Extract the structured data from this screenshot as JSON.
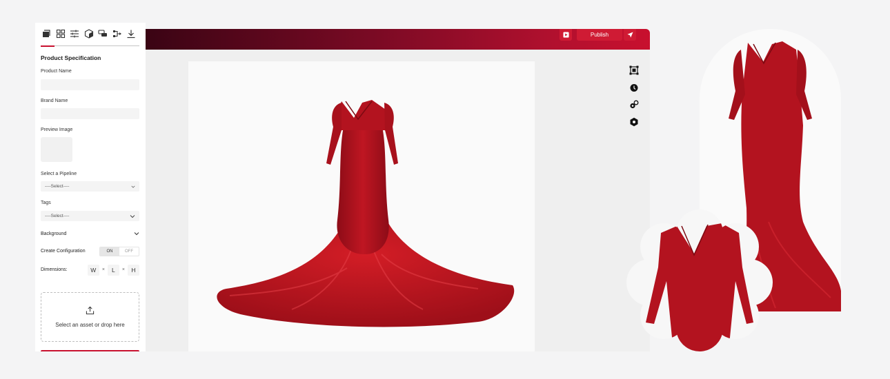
{
  "toolbar": {
    "icons": [
      "layers-icon",
      "grid-icon",
      "sliders-icon",
      "cube-icon",
      "chat-icon",
      "flow-icon",
      "download-icon"
    ]
  },
  "panel": {
    "section_title": "Product Specification",
    "product_name_label": "Product Name",
    "product_name_value": "",
    "brand_name_label": "Brand Name",
    "brand_name_value": "",
    "preview_image_label": "Preview Image",
    "pipeline_label": "Select a Pipeline",
    "pipeline_value": "----Select----",
    "tags_label": "Tags",
    "tags_value": "----Select----",
    "background_label": "Background",
    "create_config_label": "Create Configuration",
    "toggle_on": "ON",
    "toggle_off": "OFF",
    "toggle_state": "ON",
    "dimensions_label": "Dimensions:",
    "dim_w": "W",
    "dim_l": "L",
    "dim_h": "H",
    "dim_sep": "×",
    "dropzone_text": "Select an asset or drop here"
  },
  "topbar": {
    "publish_label": "Publish"
  },
  "side_tools": [
    "fit-frame-icon",
    "timer-icon",
    "settings-gears-icon",
    "hexagon-icon"
  ],
  "colors": {
    "accent": "#c8102e",
    "topbar_dark": "#3a0414",
    "dress_red": "#b3131f"
  }
}
